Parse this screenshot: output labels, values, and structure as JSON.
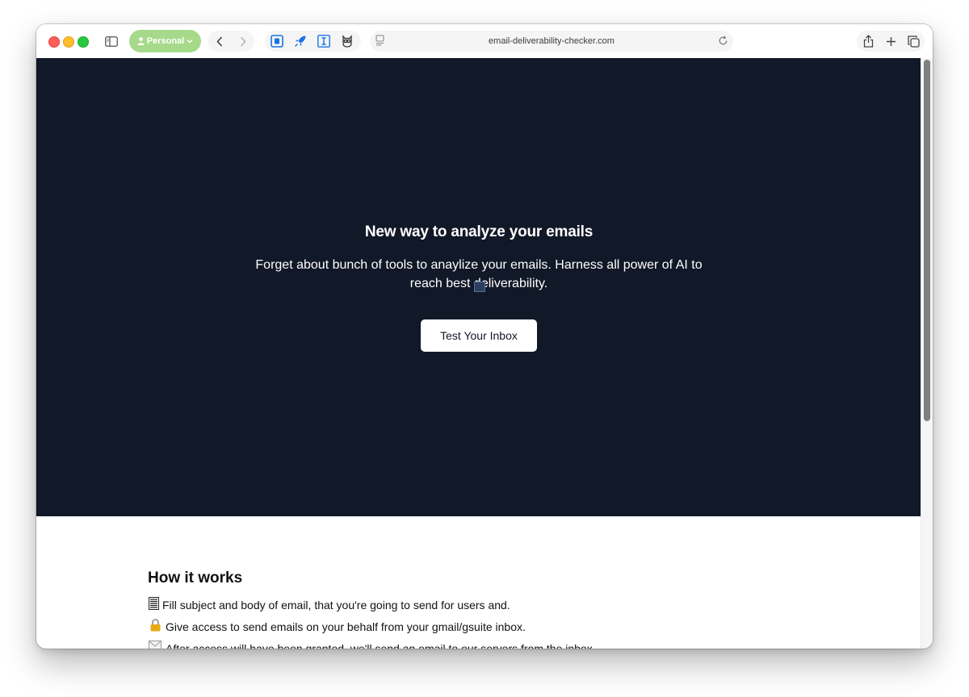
{
  "browser": {
    "profile_label": "Personal",
    "url": "email-deliverability-checker.com",
    "extensions": [
      "bitwarden-icon",
      "rocket-icon",
      "text-cursor-icon",
      "owl-icon"
    ]
  },
  "hero": {
    "title": "New way to analyze your emails",
    "subtitle": "Forget about bunch of tools to anaylize your emails. Harness all power of AI to reach best deliverability.",
    "cta_label": "Test Your Inbox",
    "background": "#111827"
  },
  "how_it_works": {
    "title": "How it works",
    "steps": [
      {
        "icon": "memo-icon",
        "text": "Fill subject and body of email, that you're going to send for users and."
      },
      {
        "icon": "lock-icon",
        "text": "Give access to send emails on your behalf from your gmail/gsuite inbox."
      },
      {
        "icon": "envelope-icon",
        "text": "After access will have been granted, we'll send an email to our servers from the inbox."
      }
    ]
  },
  "colors": {
    "profile_pill": "#a7d98b",
    "accent_blue": "#1a73e8"
  }
}
